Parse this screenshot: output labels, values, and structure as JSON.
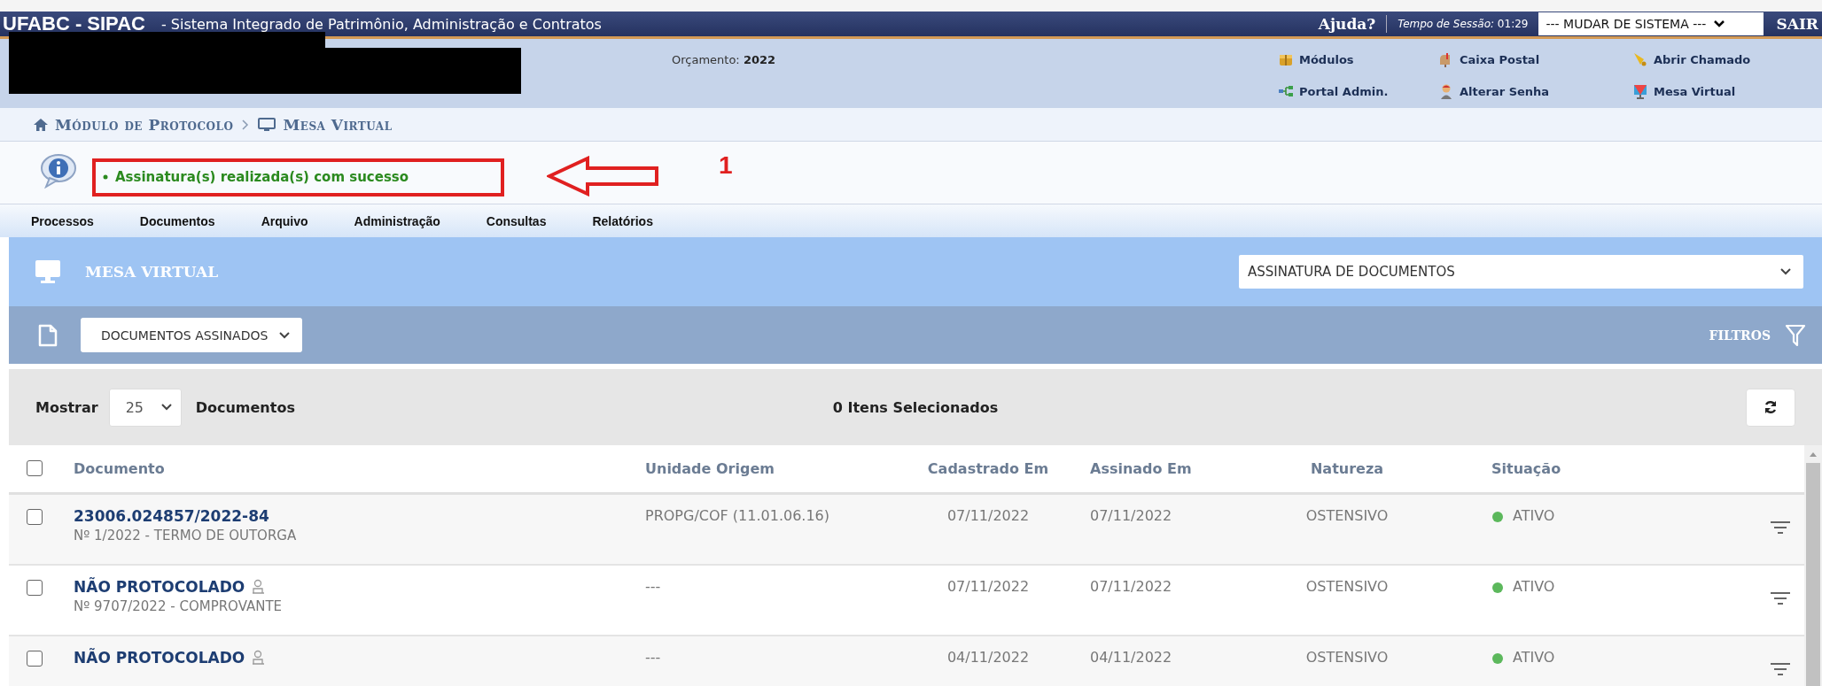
{
  "title_bar": {
    "brand": "UFABC - SIPAC",
    "system_name": "- Sistema Integrado de Patrimônio, Administração e Contratos",
    "help": "Ajuda?",
    "session_label": "Tempo de Sessão:",
    "session_time": "01:29",
    "system_select": "--- MUDAR DE SISTEMA ---",
    "logout": "SAIR"
  },
  "header": {
    "budget_label": "Orçamento:",
    "budget_year": "2022",
    "links": [
      {
        "label": "Módulos",
        "kind": "modules"
      },
      {
        "label": "Caixa Postal",
        "kind": "mailbox"
      },
      {
        "label": "Abrir Chamado",
        "kind": "bell"
      },
      {
        "label": "Portal Admin.",
        "kind": "portal"
      },
      {
        "label": "Alterar Senha",
        "kind": "user"
      },
      {
        "label": "Mesa Virtual",
        "kind": "desktop"
      }
    ]
  },
  "breadcrumb": [
    {
      "label": "Módulo de Protocolo",
      "kind": "home"
    },
    {
      "label": "Mesa Virtual",
      "kind": "desktop"
    }
  ],
  "message": {
    "text": "Assinatura(s) realizada(s) com sucesso",
    "annotation_number": "1"
  },
  "menu": [
    "Processos",
    "Documentos",
    "Arquivo",
    "Administração",
    "Consultas",
    "Relatórios"
  ],
  "panel": {
    "title": "MESA VIRTUAL",
    "view_select": "ASSINATURA DE DOCUMENTOS",
    "doc_select": "DOCUMENTOS ASSINADOS",
    "filters": "FILTROS"
  },
  "toolbar": {
    "show_label": "Mostrar",
    "page_size": "25",
    "show_suffix": "Documentos",
    "selected_count": "0 Itens Selecionados"
  },
  "table": {
    "columns": [
      "Documento",
      "Unidade Origem",
      "Cadastrado Em",
      "Assinado Em",
      "Natureza",
      "Situação"
    ],
    "header_checked": false,
    "rows": [
      {
        "checked": false,
        "document": "23006.024857/2022-84",
        "signer_icon": false,
        "subtitle": "Nº 1/2022 - TERMO DE OUTORGA",
        "origin": "PROPG/COF (11.01.06.16)",
        "registered": "07/11/2022",
        "signed": "07/11/2022",
        "nature": "OSTENSIVO",
        "status": "ATIVO",
        "color": "#5cb85c"
      },
      {
        "checked": false,
        "document": "NÃO PROTOCOLADO",
        "signer_icon": true,
        "subtitle": "Nº 9707/2022 - COMPROVANTE",
        "origin": "---",
        "registered": "07/11/2022",
        "signed": "07/11/2022",
        "nature": "OSTENSIVO",
        "status": "ATIVO",
        "color": "#5cb85c"
      },
      {
        "checked": false,
        "document": "NÃO PROTOCOLADO",
        "signer_icon": true,
        "origin": "---",
        "registered": "04/11/2022",
        "signed": "04/11/2022",
        "nature": "OSTENSIVO",
        "status": "ATIVO",
        "color": "#5cb85c"
      }
    ]
  }
}
